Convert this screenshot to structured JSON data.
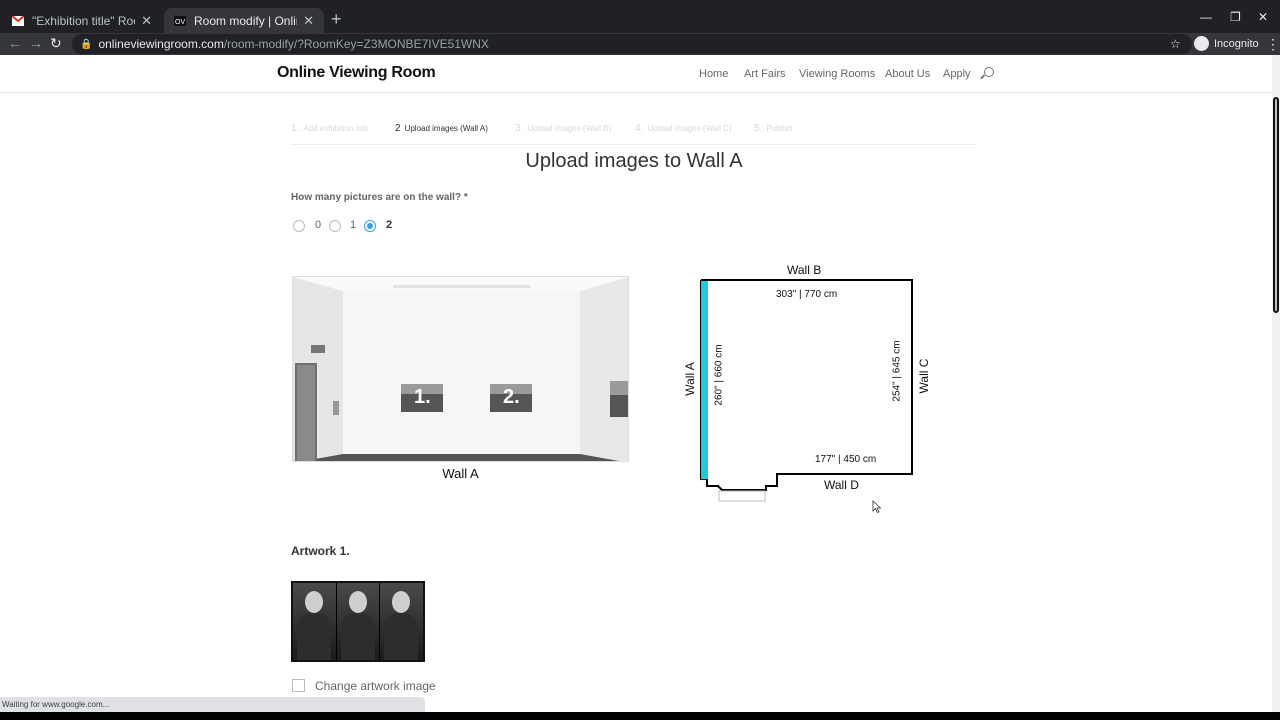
{
  "browser": {
    "tabs": [
      {
        "title": "\"Exhibition title\" Room is finished",
        "icon": "gmail-icon"
      },
      {
        "title": "Room modify | Online Viewing Room",
        "icon": "ovr-favicon"
      }
    ],
    "url_host": "onlineviewingroom.com",
    "url_path": "/room-modify/?RoomKey=Z3MONBE7IVE51WNX",
    "incognito_label": "Incognito",
    "status_text": "Waiting for www.google.com..."
  },
  "site": {
    "logo": "Online Viewing Room",
    "nav": [
      "Home",
      "Art Fairs",
      "Viewing Rooms",
      "About Us",
      "Apply"
    ]
  },
  "steps": [
    {
      "num": "1.",
      "label": "Add exhibition info"
    },
    {
      "num": "2",
      "label": "Upload images (Wall A)"
    },
    {
      "num": "3.",
      "label": "Upload images (Wall B)"
    },
    {
      "num": "4.",
      "label": "Upload images (Wall C)"
    },
    {
      "num": "5.",
      "label": "Publish"
    }
  ],
  "page_title": "Upload images to Wall A",
  "question": "How many pictures are on the wall? *",
  "picture_count_options": [
    "0",
    "1",
    "2"
  ],
  "picture_count_selected": "2",
  "room_preview": {
    "caption": "Wall A",
    "slot_labels": [
      "1.",
      "2."
    ]
  },
  "floorplan": {
    "wall_b": "Wall B",
    "wall_a": "Wall A",
    "wall_c": "Wall C",
    "wall_d": "Wall D",
    "dim_b": "303\" | 770 cm",
    "dim_a": "260\" | 660 cm",
    "dim_c": "254\" | 645 cm",
    "dim_d": "177\" | 450 cm",
    "highlight_color": "#2ec4d6"
  },
  "artwork": {
    "label": "Artwork 1.",
    "change_label": "Change artwork image"
  }
}
